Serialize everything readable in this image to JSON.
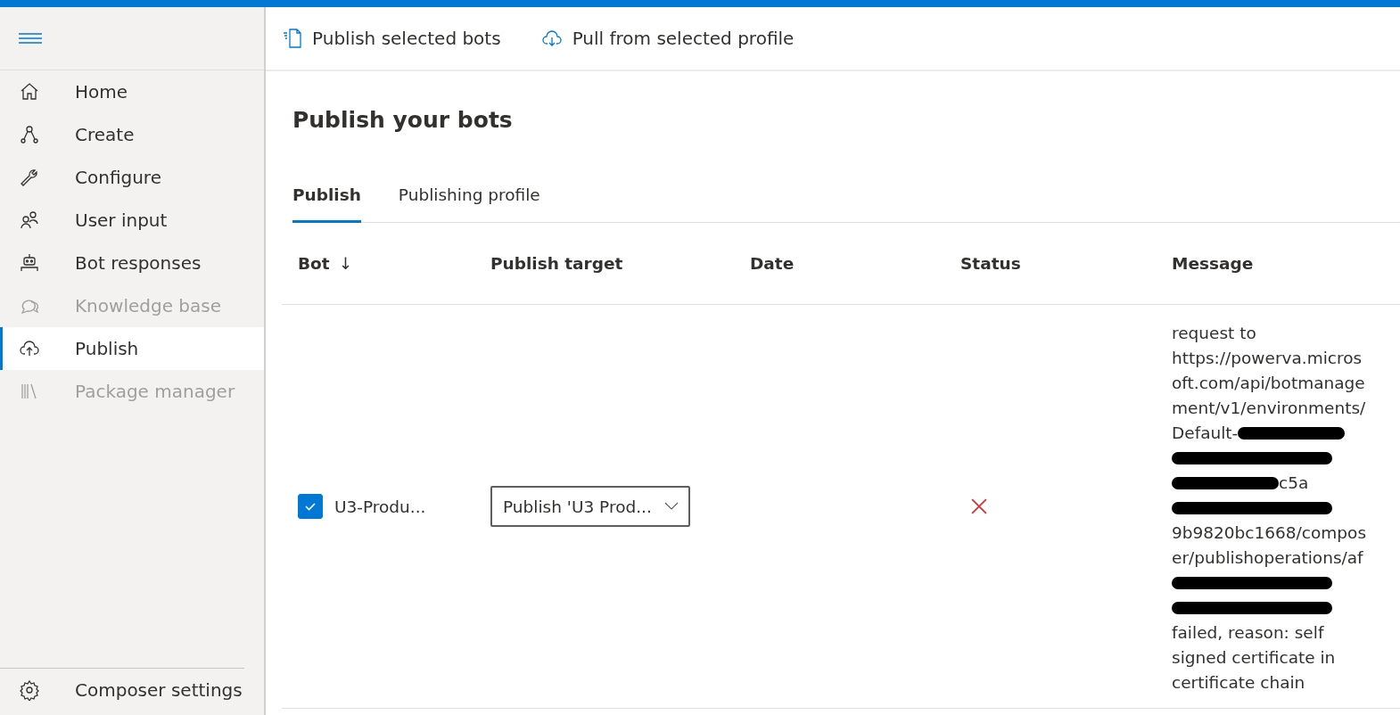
{
  "sidebar": {
    "items": [
      {
        "label": "Home",
        "disabled": false,
        "selected": false
      },
      {
        "label": "Create",
        "disabled": false,
        "selected": false
      },
      {
        "label": "Configure",
        "disabled": false,
        "selected": false
      },
      {
        "label": "User input",
        "disabled": false,
        "selected": false
      },
      {
        "label": "Bot responses",
        "disabled": false,
        "selected": false
      },
      {
        "label": "Knowledge base",
        "disabled": true,
        "selected": false
      },
      {
        "label": "Publish",
        "disabled": false,
        "selected": true
      },
      {
        "label": "Package manager",
        "disabled": true,
        "selected": false
      }
    ],
    "footer": {
      "label": "Composer settings"
    }
  },
  "toolbar": [
    {
      "label": "Publish selected bots"
    },
    {
      "label": "Pull from selected profile"
    }
  ],
  "title": "Publish your bots",
  "tabs": [
    {
      "label": "Publish",
      "selected": true
    },
    {
      "label": "Publishing profile",
      "selected": false
    }
  ],
  "table": {
    "columns": [
      {
        "label": "Bot",
        "sort": "↓"
      },
      {
        "label": "Publish target"
      },
      {
        "label": "Date"
      },
      {
        "label": "Status"
      },
      {
        "label": "Message"
      }
    ],
    "rows": [
      {
        "checked": true,
        "bot": "U3-Produ...",
        "target": "Publish 'U3 Prod...",
        "failed": true,
        "message": [
          {
            "kind": "plain",
            "text": "request to"
          },
          {
            "kind": "plain",
            "text": "https://powerva.micros"
          },
          {
            "kind": "plain",
            "text": "oft.com/api/botmanage"
          },
          {
            "kind": "plain",
            "text": "ment/v1/environments/"
          },
          {
            "kind": "redacted_end",
            "text": "Default-"
          },
          {
            "kind": "redacted"
          },
          {
            "kind": "redacted_start",
            "text": "c5a"
          },
          {
            "kind": "redacted"
          },
          {
            "kind": "plain",
            "text": "9b9820bc1668/compos"
          },
          {
            "kind": "plain",
            "text": "er/publishoperations/af"
          },
          {
            "kind": "redacted"
          },
          {
            "kind": "redacted"
          },
          {
            "kind": "plain",
            "text": "failed, reason: self"
          },
          {
            "kind": "plain",
            "text": "signed certificate in"
          },
          {
            "kind": "plain",
            "text": "certificate chain"
          }
        ]
      }
    ]
  }
}
